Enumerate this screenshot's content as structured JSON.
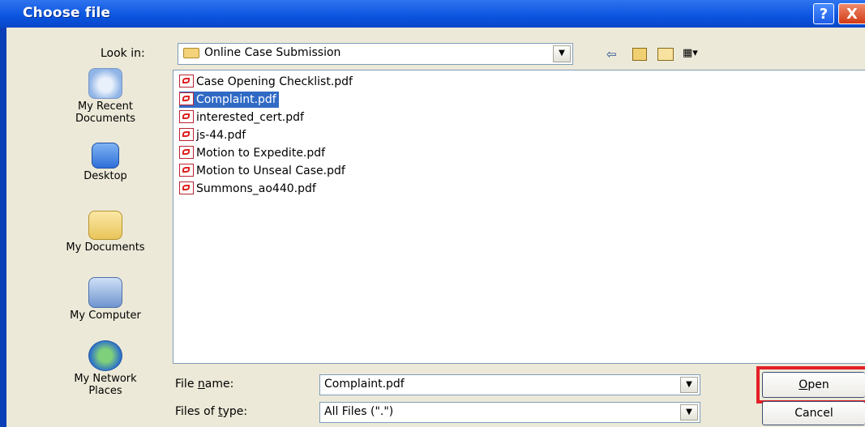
{
  "window": {
    "title": "Choose file",
    "help_label": "?",
    "close_label": "X"
  },
  "look_in": {
    "label": "Look in:",
    "value": "Online Case Submission"
  },
  "toolbar": {
    "back_icon": "back-arrow-icon",
    "up_icon": "up-folder-icon",
    "new_folder_icon": "new-folder-icon",
    "view_icon": "view-menu-icon"
  },
  "places": [
    {
      "label": "My Recent Documents",
      "icon": "recent-documents-icon"
    },
    {
      "label": "Desktop",
      "icon": "desktop-icon"
    },
    {
      "label": "My Documents",
      "icon": "my-documents-icon"
    },
    {
      "label": "My Computer",
      "icon": "my-computer-icon"
    },
    {
      "label": "My Network Places",
      "icon": "network-places-icon"
    }
  ],
  "files": [
    {
      "name": "Case Opening Checklist.pdf",
      "selected": false
    },
    {
      "name": "Complaint.pdf",
      "selected": true
    },
    {
      "name": "interested_cert.pdf",
      "selected": false
    },
    {
      "name": "js-44.pdf",
      "selected": false
    },
    {
      "name": "Motion to Expedite.pdf",
      "selected": false
    },
    {
      "name": "Motion to Unseal Case.pdf",
      "selected": false
    },
    {
      "name": "Summons_ao440.pdf",
      "selected": false
    }
  ],
  "filename": {
    "label_pre": "File ",
    "label_key": "n",
    "label_post": "ame:",
    "value": "Complaint.pdf"
  },
  "filetype": {
    "label_pre": "Files of ",
    "label_key": "t",
    "label_post": "ype:",
    "value": "All Files (\".\")"
  },
  "buttons": {
    "open_key": "O",
    "open_rest": "pen",
    "cancel": "Cancel"
  },
  "colors": {
    "titlebar": "#0a54e0",
    "selection": "#316ac5",
    "highlight_box": "#e31f26"
  }
}
